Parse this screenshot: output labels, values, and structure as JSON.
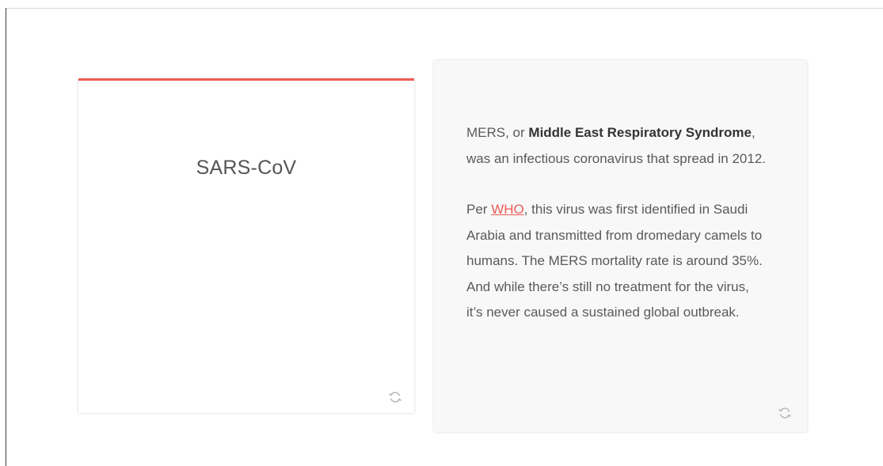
{
  "colors": {
    "accent": "#ef5b55",
    "text": "#5a5a5a",
    "strong_text": "#333333",
    "card_back_bg": "#f8f8f8"
  },
  "front_card": {
    "title": "SARS-CoV",
    "flip_icon": "refresh-icon"
  },
  "back_card": {
    "p1_a": "MERS, or ",
    "p1_bold": "Middle East Respiratory Syndrome",
    "p1_b": ", was an infectious coronavirus that spread in 2012.",
    "p2_a": "Per ",
    "p2_link": "WHO",
    "p2_b": ", this virus was first identified in Saudi Arabia and transmitted from dromedary camels to humans. The MERS mortality rate is around 35%. And while there’s still no treatment for the virus, it’s never caused a sustained global outbreak.",
    "flip_icon": "refresh-icon"
  }
}
